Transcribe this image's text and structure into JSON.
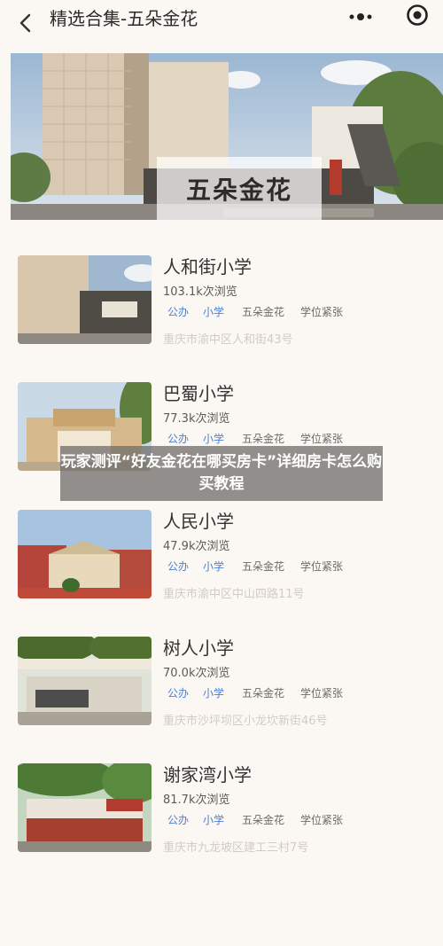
{
  "nav": {
    "title": "精选合集-五朵金花"
  },
  "banner": {
    "label": "五朵金花"
  },
  "overlay": {
    "text": "玩家测评“好友金花在哪买房卡”详细房卡怎么购买教程"
  },
  "schools": [
    {
      "name": "人和街小学",
      "views": "103.1k次浏览",
      "tags": [
        "公办",
        "小学",
        "五朵金花",
        "学位紧张"
      ],
      "address": "重庆市渝中区人和街43号"
    },
    {
      "name": "巴蜀小学",
      "views": "77.3k次浏览",
      "tags": [
        "公办",
        "小学",
        "五朵金花",
        "学位紧张"
      ],
      "address": ""
    },
    {
      "name": "人民小学",
      "views": "47.9k次浏览",
      "tags": [
        "公办",
        "小学",
        "五朵金花",
        "学位紧张"
      ],
      "address": "重庆市渝中区中山四路11号"
    },
    {
      "name": "树人小学",
      "views": "70.0k次浏览",
      "tags": [
        "公办",
        "小学",
        "五朵金花",
        "学位紧张"
      ],
      "address": "重庆市沙坪坝区小龙坎新街46号"
    },
    {
      "name": "谢家湾小学",
      "views": "81.7k次浏览",
      "tags": [
        "公办",
        "小学",
        "五朵金花",
        "学位紧张"
      ],
      "address": "重庆市九龙坡区建工三村7号"
    }
  ],
  "colors": {
    "tag_blue": "#4a7fd8",
    "background": "#fbf8f3"
  }
}
